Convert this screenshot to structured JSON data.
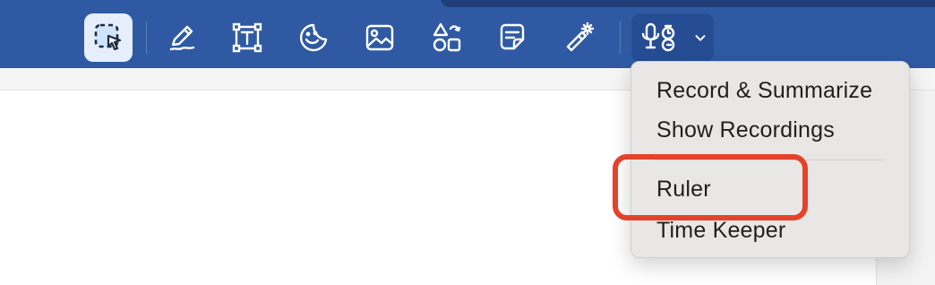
{
  "toolbar": {
    "tools": [
      {
        "icon": "selection-tool-icon"
      },
      {
        "icon": "pencil-icon"
      },
      {
        "icon": "text-box-icon"
      },
      {
        "icon": "sticker-icon"
      },
      {
        "icon": "image-icon"
      },
      {
        "icon": "shapes-icon"
      },
      {
        "icon": "sticky-note-icon"
      },
      {
        "icon": "magic-wand-icon"
      },
      {
        "icon": "microphone-timer-icon"
      }
    ],
    "accent_color": "#2f5aa3"
  },
  "menu": {
    "items": [
      {
        "label": "Record & Summarize"
      },
      {
        "label": "Show Recordings"
      },
      {
        "label": "Ruler"
      },
      {
        "label": "Time Keeper"
      }
    ]
  },
  "highlight_color": "#e4432b"
}
